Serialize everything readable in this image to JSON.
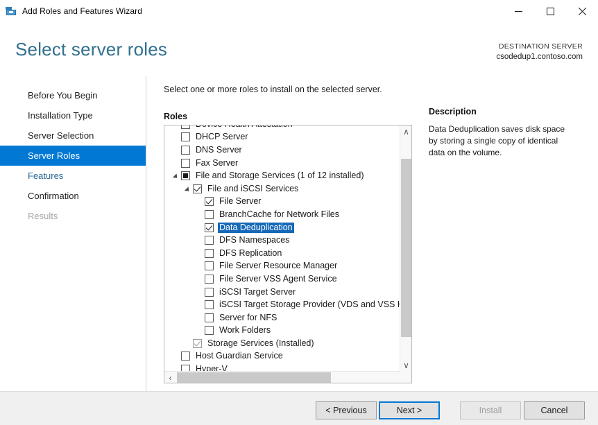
{
  "window": {
    "title": "Add Roles and Features Wizard",
    "icon": "server-wizard-icon",
    "minimize_label": "Minimize",
    "maximize_label": "Maximize",
    "close_label": "Close"
  },
  "header": {
    "page_title": "Select server roles",
    "destination_label": "DESTINATION SERVER",
    "destination_value": "csodedup1.contoso.com",
    "title_color": "#31708f"
  },
  "sidebar": {
    "items": [
      {
        "label": "Before You Begin",
        "state": "normal"
      },
      {
        "label": "Installation Type",
        "state": "normal"
      },
      {
        "label": "Server Selection",
        "state": "normal"
      },
      {
        "label": "Server Roles",
        "state": "selected"
      },
      {
        "label": "Features",
        "state": "link"
      },
      {
        "label": "Confirmation",
        "state": "normal"
      },
      {
        "label": "Results",
        "state": "disabled"
      }
    ],
    "selected_color": "#0078d4"
  },
  "main": {
    "instruction": "Select one or more roles to install on the selected server.",
    "roles_label": "Roles",
    "description_label": "Description",
    "description_text": "Data Deduplication saves disk space by storing a single copy of identical data on the volume.",
    "selection_color": "#1669b8"
  },
  "roles_tree": [
    {
      "label": "Device Health Attestation",
      "indent": 0,
      "checkbox": "unchecked",
      "twisty": "none",
      "selected": false,
      "clipped": true
    },
    {
      "label": "DHCP Server",
      "indent": 0,
      "checkbox": "unchecked",
      "twisty": "none",
      "selected": false
    },
    {
      "label": "DNS Server",
      "indent": 0,
      "checkbox": "unchecked",
      "twisty": "none",
      "selected": false
    },
    {
      "label": "Fax Server",
      "indent": 0,
      "checkbox": "unchecked",
      "twisty": "none",
      "selected": false
    },
    {
      "label": "File and Storage Services (1 of 12 installed)",
      "indent": 0,
      "checkbox": "partial",
      "twisty": "open",
      "selected": false
    },
    {
      "label": "File and iSCSI Services",
      "indent": 1,
      "checkbox": "checked",
      "twisty": "open",
      "selected": false
    },
    {
      "label": "File Server",
      "indent": 2,
      "checkbox": "checked",
      "twisty": "none",
      "selected": false
    },
    {
      "label": "BranchCache for Network Files",
      "indent": 2,
      "checkbox": "unchecked",
      "twisty": "none",
      "selected": false
    },
    {
      "label": "Data Deduplication",
      "indent": 2,
      "checkbox": "checked",
      "twisty": "none",
      "selected": true
    },
    {
      "label": "DFS Namespaces",
      "indent": 2,
      "checkbox": "unchecked",
      "twisty": "none",
      "selected": false
    },
    {
      "label": "DFS Replication",
      "indent": 2,
      "checkbox": "unchecked",
      "twisty": "none",
      "selected": false
    },
    {
      "label": "File Server Resource Manager",
      "indent": 2,
      "checkbox": "unchecked",
      "twisty": "none",
      "selected": false
    },
    {
      "label": "File Server VSS Agent Service",
      "indent": 2,
      "checkbox": "unchecked",
      "twisty": "none",
      "selected": false
    },
    {
      "label": "iSCSI Target Server",
      "indent": 2,
      "checkbox": "unchecked",
      "twisty": "none",
      "selected": false
    },
    {
      "label": "iSCSI Target Storage Provider (VDS and VSS Hardware Providers)",
      "indent": 2,
      "checkbox": "unchecked",
      "twisty": "none",
      "selected": false
    },
    {
      "label": "Server for NFS",
      "indent": 2,
      "checkbox": "unchecked",
      "twisty": "none",
      "selected": false
    },
    {
      "label": "Work Folders",
      "indent": 2,
      "checkbox": "unchecked",
      "twisty": "none",
      "selected": false
    },
    {
      "label": "Storage Services (Installed)",
      "indent": 1,
      "checkbox": "greyed-checked",
      "twisty": "none",
      "selected": false
    },
    {
      "label": "Host Guardian Service",
      "indent": 0,
      "checkbox": "unchecked",
      "twisty": "none",
      "selected": false
    },
    {
      "label": "Hyper-V",
      "indent": 0,
      "checkbox": "unchecked",
      "twisty": "none",
      "selected": false,
      "clipped": true
    }
  ],
  "scrollbars": {
    "vertical_up_glyph": "∧",
    "vertical_down_glyph": "∨",
    "horizontal_left_glyph": "‹",
    "horizontal_right_glyph": "›"
  },
  "footer": {
    "buttons": [
      {
        "id": "previous",
        "label": "< Previous",
        "state": "enabled"
      },
      {
        "id": "next",
        "label": "Next >",
        "state": "focused"
      },
      {
        "id": "install",
        "label": "Install",
        "state": "disabled"
      },
      {
        "id": "cancel",
        "label": "Cancel",
        "state": "enabled"
      }
    ]
  }
}
